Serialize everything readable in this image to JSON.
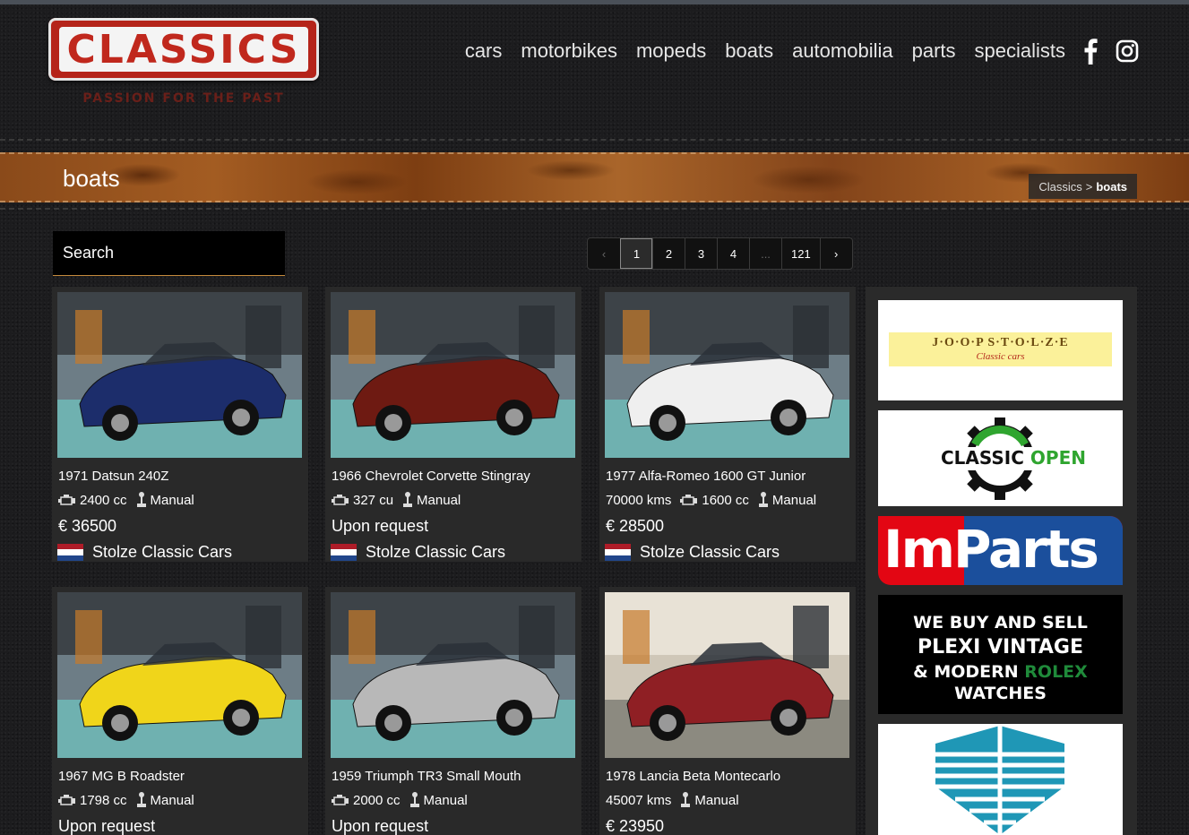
{
  "header": {
    "logo_text": "CLASSICS",
    "logo_tagline": "PASSION FOR THE PAST",
    "nav": [
      "cars",
      "motorbikes",
      "mopeds",
      "boats",
      "automobilia",
      "parts",
      "specialists"
    ],
    "social_icons": [
      "facebook-icon",
      "instagram-icon"
    ]
  },
  "banner": {
    "title": "boats",
    "breadcrumb_root": "Classics",
    "breadcrumb_sep": ">",
    "breadcrumb_current": "boats"
  },
  "search": {
    "placeholder": "Search"
  },
  "pagination": [
    "‹",
    "1",
    "2",
    "3",
    "4",
    "...",
    "121",
    "›"
  ],
  "listings": [
    {
      "title": "1971 Datsun 240Z",
      "mileage": "",
      "engine": "2400 cc",
      "transmission": "Manual",
      "price": "€ 36500",
      "seller": "Stolze Classic Cars",
      "car_color": "#1c2d6b"
    },
    {
      "title": "1966 Chevrolet Corvette Stingray",
      "mileage": "",
      "engine": "327 cu",
      "transmission": "Manual",
      "price": "Upon request",
      "seller": "Stolze Classic Cars",
      "car_color": "#6e1a12"
    },
    {
      "title": "1977 Alfa-Romeo 1600 GT Junior",
      "mileage": "70000 kms",
      "engine": "1600 cc",
      "transmission": "Manual",
      "price": "€ 28500",
      "seller": "Stolze Classic Cars",
      "car_color": "#efefef"
    },
    {
      "title": "1967 MG B Roadster",
      "mileage": "",
      "engine": "1798 cc",
      "transmission": "Manual",
      "price": "Upon request",
      "seller": "",
      "car_color": "#f0d51a"
    },
    {
      "title": "1959 Triumph TR3 Small Mouth",
      "mileage": "",
      "engine": "2000 cc",
      "transmission": "Manual",
      "price": "Upon request",
      "seller": "",
      "car_color": "#b8b8b8"
    },
    {
      "title": "1978 Lancia Beta Montecarlo",
      "mileage": "45007 kms",
      "engine": "",
      "transmission": "Manual",
      "price": "€ 23950",
      "seller": "",
      "car_color": "#8f1f24"
    }
  ],
  "ads": [
    {
      "name": "joop-stolze-ad",
      "text": "J·O·O·P  S·T·O·L·Z·E",
      "subtext": "Classic cars"
    },
    {
      "name": "classic-open-ad",
      "text": "CLASSIC",
      "text2": "OPEN"
    },
    {
      "name": "imparts-ad",
      "text": "ImParts"
    },
    {
      "name": "rolex-ad",
      "line1": "WE BUY AND SELL",
      "line2": "PLEXI VINTAGE",
      "line3a": "& MODERN ",
      "line3b": "ROLEX",
      "line4": "WATCHES"
    },
    {
      "name": "building-logo-ad"
    }
  ],
  "colors": {
    "accent_red": "#c0281d",
    "nl_flag": [
      "#ae1c28",
      "#ffffff",
      "#21468b"
    ],
    "classic_open_green": "#2fa52f",
    "imparts_red": "#e30613",
    "imparts_blue": "#1b4f9c",
    "rolex_green": "#1f8a3a"
  }
}
